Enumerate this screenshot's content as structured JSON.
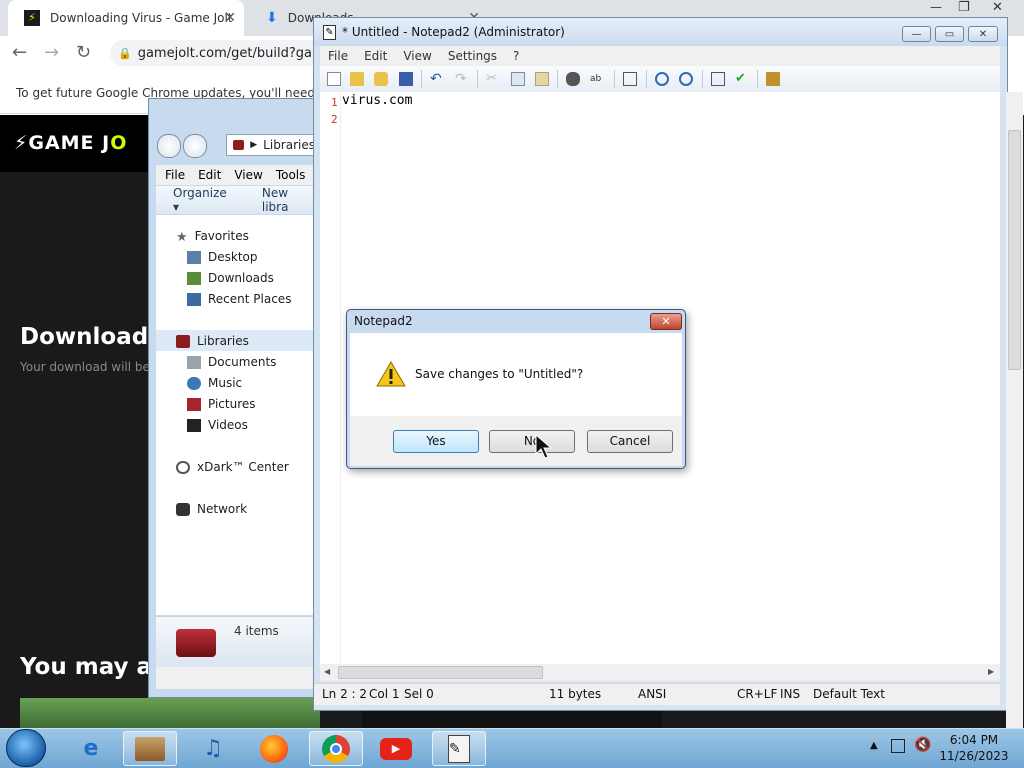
{
  "chrome": {
    "tabs": [
      {
        "title": "Downloading Virus - Game Jolt",
        "close": "✕"
      },
      {
        "title": "Downloads",
        "close": "✕"
      }
    ],
    "url": "gamejolt.com/get/build?ga",
    "infobar": "To get future Google Chrome updates, you'll need W",
    "window_controls": {
      "minimize": "—",
      "restore": "❐",
      "close": "✕"
    }
  },
  "gamejolt": {
    "logo_a": "GAME J",
    "logo_b": "O",
    "title": "Downloadin",
    "subtitle": "Your download will be",
    "section": "You may als"
  },
  "explorer": {
    "address": "Libraries",
    "menu": [
      "File",
      "Edit",
      "View",
      "Tools"
    ],
    "cmd": {
      "organize": "Organize ▾",
      "new_library": "New libra"
    },
    "favorites": {
      "label": "Favorites",
      "items": [
        "Desktop",
        "Downloads",
        "Recent Places"
      ]
    },
    "libraries": {
      "label": "Libraries",
      "items": [
        "Documents",
        "Music",
        "Pictures",
        "Videos"
      ]
    },
    "xdark": "xDark™ Center",
    "network": "Network",
    "details": "4 items"
  },
  "notepad": {
    "title": "* Untitled - Notepad2 (Administrator)",
    "menu": [
      "File",
      "Edit",
      "View",
      "Settings",
      "?"
    ],
    "lines": [
      "virus.com",
      ""
    ],
    "line_numbers": [
      "1",
      "2"
    ],
    "status": {
      "position": "Ln 2 : 2",
      "col": "Col 1",
      "sel": "Sel 0",
      "size": "11 bytes",
      "encoding": "ANSI",
      "eol": "CR+LF",
      "mode": "INS",
      "scheme": "Default Text"
    }
  },
  "dialog": {
    "title": "Notepad2",
    "message": "Save changes to \"Untitled\"?",
    "buttons": {
      "yes": "Yes",
      "no": "No",
      "cancel": "Cancel"
    },
    "close": "✕"
  },
  "taskbar": {
    "time": "6:04 PM",
    "date": "11/26/2023"
  }
}
